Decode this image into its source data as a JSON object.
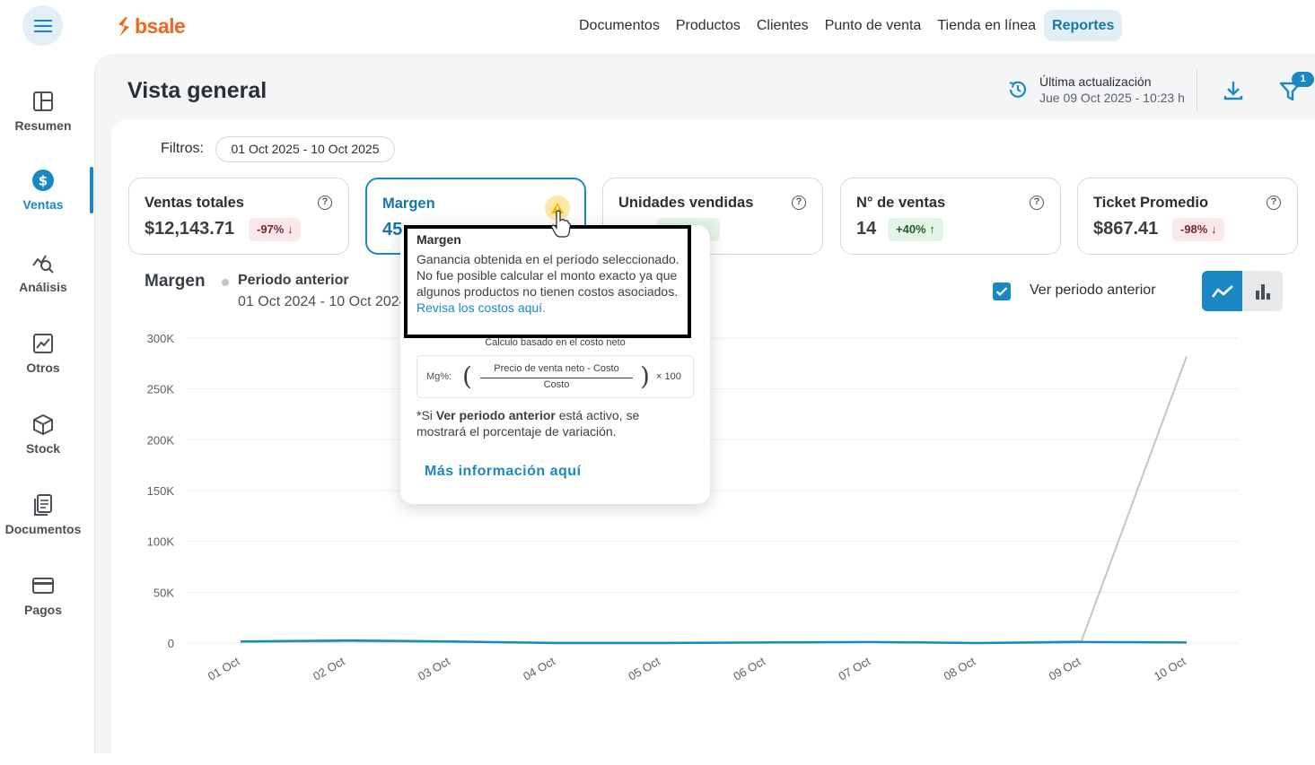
{
  "brand": {
    "name": "bsale"
  },
  "topnav": [
    "Documentos",
    "Productos",
    "Clientes",
    "Punto de venta",
    "Tienda en línea",
    "Reportes"
  ],
  "sidebar": [
    {
      "label": "Resumen",
      "icon": "layout-icon"
    },
    {
      "label": "Ventas",
      "icon": "dollar-icon"
    },
    {
      "label": "Análisis",
      "icon": "analysis-icon"
    },
    {
      "label": "Otros",
      "icon": "trend-icon"
    },
    {
      "label": "Stock",
      "icon": "box-icon"
    },
    {
      "label": "Documentos",
      "icon": "document-icon"
    },
    {
      "label": "Pagos",
      "icon": "card-icon"
    }
  ],
  "page": {
    "title": "Vista general",
    "last_update_label": "Última actualización",
    "last_update_value": "Jue 09 Oct 2025 - 10:23 h",
    "filter_count": "1"
  },
  "filters": {
    "label": "Filtros:",
    "date_range": "01 Oct 2025 - 10 Oct 2025"
  },
  "cards": [
    {
      "title": "Ventas totales",
      "value": "$12,143.71",
      "badge": "-97%",
      "trend": "down"
    },
    {
      "title": "Margen",
      "value": "45",
      "badge": "",
      "trend": "warn"
    },
    {
      "title": "Unidades vendidas",
      "value": "",
      "badge": "",
      "trend": "up"
    },
    {
      "title": "N° de ventas",
      "value": "14",
      "badge": "+40%",
      "trend": "up"
    },
    {
      "title": "Ticket Promedio",
      "value": "$867.41",
      "badge": "-98%",
      "trend": "down"
    }
  ],
  "chart_header": {
    "title": "Margen",
    "prev_label": "Periodo anterior",
    "prev_range": "01 Oct 2024 - 10 Oct 2024",
    "checkbox_label": "Ver periodo anterior"
  },
  "tooltip": {
    "title": "Margen",
    "desc": "Ganancia obtenida en el período seleccionado. No fue posible calcular el monto exacto ya que algunos productos no tienen costos asociados.",
    "link": "Revisa los costos aquí.",
    "sub": "Calculo basado en el costo neto",
    "formula_label": "Mg%:",
    "formula_num": "Precio de venta neto - Costo",
    "formula_den": "Costo",
    "formula_times": "× 100",
    "note_prefix": "*Si",
    "note_bold": "Ver periodo anterior",
    "note_suffix": "está activo, se mostrará el porcentaje de variación.",
    "more": "Más información aquí"
  },
  "colors": {
    "accent": "#1a88c4",
    "brand": "#f26522",
    "prev_series": "#c2c5c9"
  },
  "chart_data": {
    "type": "line",
    "x": [
      "01 Oct",
      "02 Oct",
      "03 Oct",
      "04 Oct",
      "05 Oct",
      "06 Oct",
      "07 Oct",
      "08 Oct",
      "09 Oct",
      "10 Oct"
    ],
    "yticks": [
      "300K",
      "250K",
      "200K",
      "150K",
      "100K",
      "50K",
      "0"
    ],
    "ylim": [
      0,
      300000
    ],
    "series": [
      {
        "name": "",
        "values": [
          1500,
          2500,
          1500,
          0,
          0,
          500,
          1000,
          0,
          1000,
          500
        ]
      },
      {
        "name": "Periodo anterior",
        "values": [
          1000,
          1500,
          1000,
          500,
          500,
          500,
          1000,
          0,
          2000,
          282000
        ]
      }
    ],
    "legend": "top-left",
    "grid": true
  }
}
